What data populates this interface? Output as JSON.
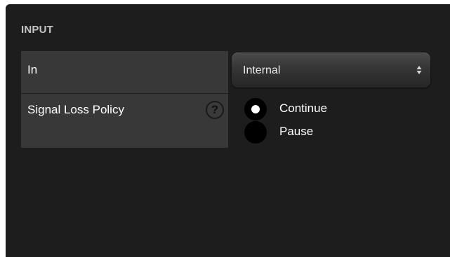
{
  "section": {
    "title": "INPUT"
  },
  "rows": {
    "in": {
      "label": "In",
      "value": "Internal"
    },
    "signal_loss_policy": {
      "label": "Signal Loss Policy",
      "help_icon": "?",
      "options": [
        {
          "label": "Continue",
          "selected": true
        },
        {
          "label": "Pause",
          "selected": false
        }
      ]
    }
  },
  "colors": {
    "panel_background": "#1d1d1d",
    "label_background": "#383838",
    "text": "#ffffff",
    "section_title": "#c4c4c4"
  },
  "icons": {
    "help": "question-circle-icon",
    "select_arrows": "up-down-arrows-icon",
    "radio_selected": "radio-checked-icon",
    "radio_unselected": "radio-unchecked-icon"
  }
}
